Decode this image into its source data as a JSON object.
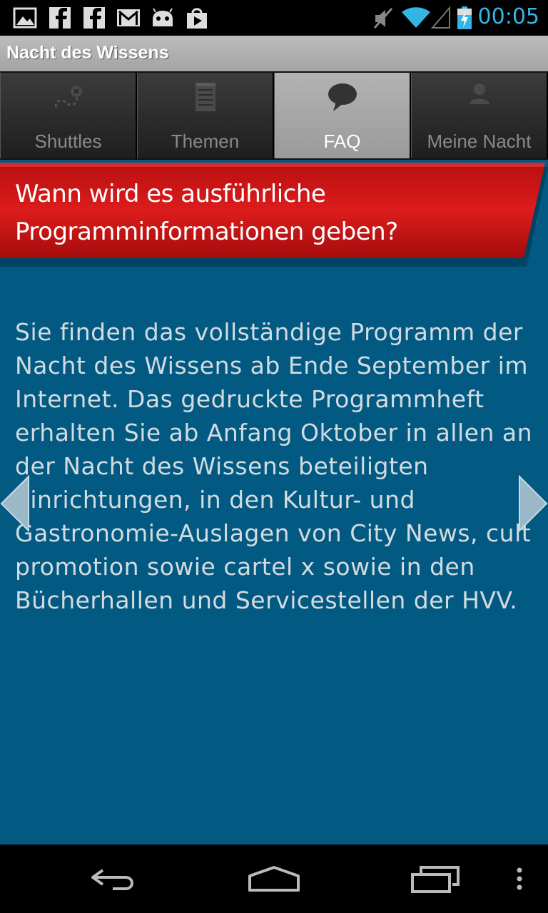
{
  "status_bar": {
    "time": "00:05",
    "left_icons": [
      "gallery-icon",
      "facebook-icon",
      "facebook-icon",
      "gmail-icon",
      "android-icon",
      "play-store-icon"
    ],
    "right_icons": [
      "mute-icon",
      "wifi-icon",
      "signal-icon",
      "battery-charging-icon"
    ],
    "time_color": "#33b5e5"
  },
  "app": {
    "title": "Nacht des Wissens"
  },
  "tabs": [
    {
      "label": "Shuttles",
      "icon": "route-icon",
      "active": false
    },
    {
      "label": "Themen",
      "icon": "notepad-icon",
      "active": false
    },
    {
      "label": "FAQ",
      "icon": "speech-bubble-icon",
      "active": true
    },
    {
      "label": "Meine Nacht",
      "icon": "person-icon",
      "active": false
    }
  ],
  "faq": {
    "question_line1": "Wann wird es ausführliche",
    "question_line2": "Programminformationen geben?",
    "answer": "Sie finden das vollständige Programm der Nacht des Wissens ab Ende September im Internet. Das gedruckte Programmheft erhalten Sie ab Anfang Oktober in allen an der Nacht des Wissens beteiligten Einrichtungen, in den Kultur- und Gastronomie-Auslagen von City News, cult promotion sowie cartel x sowie in den Bücherhallen und Servicestellen der HVV."
  },
  "colors": {
    "content_bg": "#025a82",
    "banner_red": "#d01a1a",
    "answer_text": "#d3dbe0"
  },
  "navigation": {
    "back_icon": "back-icon",
    "home_icon": "home-icon",
    "recents_icon": "recent-apps-icon",
    "menu_icon": "overflow-menu-icon"
  }
}
